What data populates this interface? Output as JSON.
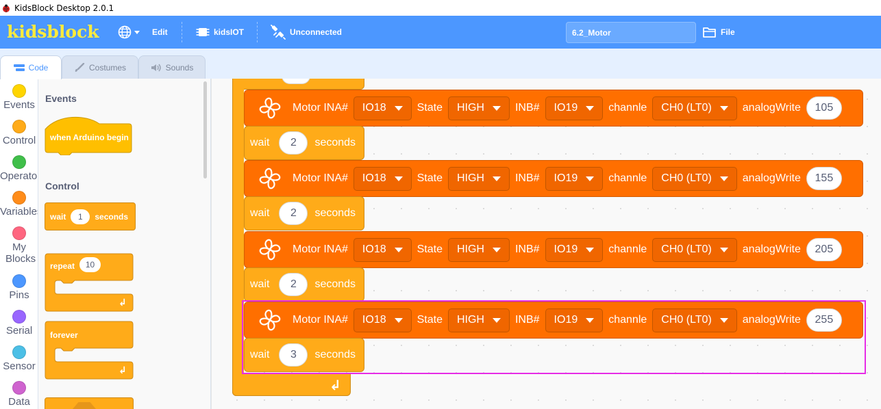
{
  "window": {
    "title": "KidsBlock Desktop 2.0.1",
    "icon": "ladybug-icon"
  },
  "menubar": {
    "logo": "kidsblock",
    "language_icon": "globe-icon",
    "edit_label": "Edit",
    "kidsiot_label": "kidsIOT",
    "connection_label": "Unconnected",
    "project_name": "6.2_Motor",
    "file_label": "File"
  },
  "tabs": [
    {
      "label": "Code",
      "icon": "code-icon",
      "active": true
    },
    {
      "label": "Costumes",
      "icon": "brush-icon",
      "active": false
    },
    {
      "label": "Sounds",
      "icon": "speaker-icon",
      "active": false
    }
  ],
  "categories": [
    {
      "label": "Events",
      "color": "#ffd500"
    },
    {
      "label": "Control",
      "color": "#ffab19"
    },
    {
      "label": "Operators",
      "color": "#40bf4a"
    },
    {
      "label": "Variables",
      "color": "#ff8c1a"
    },
    {
      "label": "My Blocks",
      "color": "#ff6680"
    },
    {
      "label": "Pins",
      "color": "#4c97ff"
    },
    {
      "label": "Serial",
      "color": "#9966ff"
    },
    {
      "label": "Sensor",
      "color": "#4cbfe6"
    },
    {
      "label": "Data",
      "color": "#cf63cf"
    }
  ],
  "palette": {
    "events_heading": "Events",
    "when_begin": "when Arduino begin",
    "control_heading": "Control",
    "wait_label": "wait",
    "wait_value": "1",
    "wait_suffix": "seconds",
    "repeat_label": "repeat",
    "repeat_value": "10",
    "forever_label": "forever"
  },
  "workspace": {
    "motor_blocks": [
      {
        "ina_label": "Motor INA#",
        "ina": "IO18",
        "state_label": "State",
        "state": "HIGH",
        "inb_label": "INB#",
        "inb": "IO19",
        "channel_label": "channle",
        "channel": "CH0 (LT0)",
        "analog_label": "analogWrite",
        "analog": "105",
        "wait_label": "wait",
        "wait_value": "2",
        "wait_suffix": "seconds"
      },
      {
        "ina_label": "Motor INA#",
        "ina": "IO18",
        "state_label": "State",
        "state": "HIGH",
        "inb_label": "INB#",
        "inb": "IO19",
        "channel_label": "channle",
        "channel": "CH0 (LT0)",
        "analog_label": "analogWrite",
        "analog": "155",
        "wait_label": "wait",
        "wait_value": "2",
        "wait_suffix": "seconds"
      },
      {
        "ina_label": "Motor INA#",
        "ina": "IO18",
        "state_label": "State",
        "state": "HIGH",
        "inb_label": "INB#",
        "inb": "IO19",
        "channel_label": "channle",
        "channel": "CH0 (LT0)",
        "analog_label": "analogWrite",
        "analog": "205",
        "wait_label": "wait",
        "wait_value": "2",
        "wait_suffix": "seconds"
      },
      {
        "ina_label": "Motor INA#",
        "ina": "IO18",
        "state_label": "State",
        "state": "HIGH",
        "inb_label": "INB#",
        "inb": "IO19",
        "channel_label": "channle",
        "channel": "CH0 (LT0)",
        "analog_label": "analogWrite",
        "analog": "255",
        "wait_label": "wait",
        "wait_value": "3",
        "wait_suffix": "seconds"
      }
    ],
    "highlight_color": "#e62ce6"
  }
}
